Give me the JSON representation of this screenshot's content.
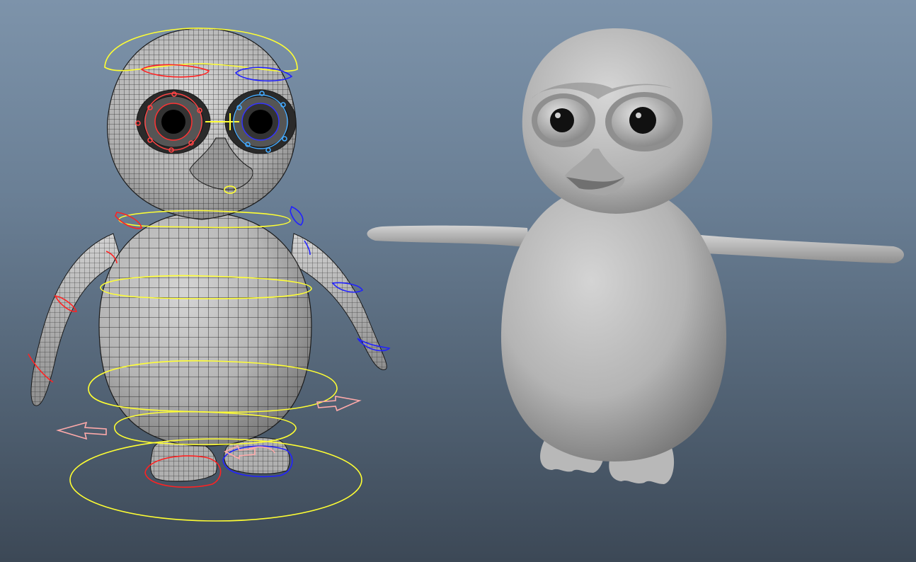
{
  "viewport": {
    "panel": "3d-perspective-viewport",
    "background_top": "#7d93aa",
    "background_bottom": "#3c4856"
  },
  "models": [
    {
      "name": "rigged-penguin",
      "display": "wireframe-on-shaded",
      "controls": {
        "global_color": "#ffff33",
        "left_side_color": "#ff2222",
        "right_side_color": "#2222ff",
        "facial_color_left": "#ff4444",
        "facial_color_right": "#44aaff",
        "direction_arrow_color": "#ffaaaa"
      }
    },
    {
      "name": "smooth-penguin",
      "display": "smooth-shaded",
      "pose": "t-pose"
    }
  ],
  "colors": {
    "surface_light": "#c9c9c9",
    "surface_mid": "#a9a9a9",
    "surface_dark": "#6e6e6e",
    "wire": "#1a1a1a"
  }
}
